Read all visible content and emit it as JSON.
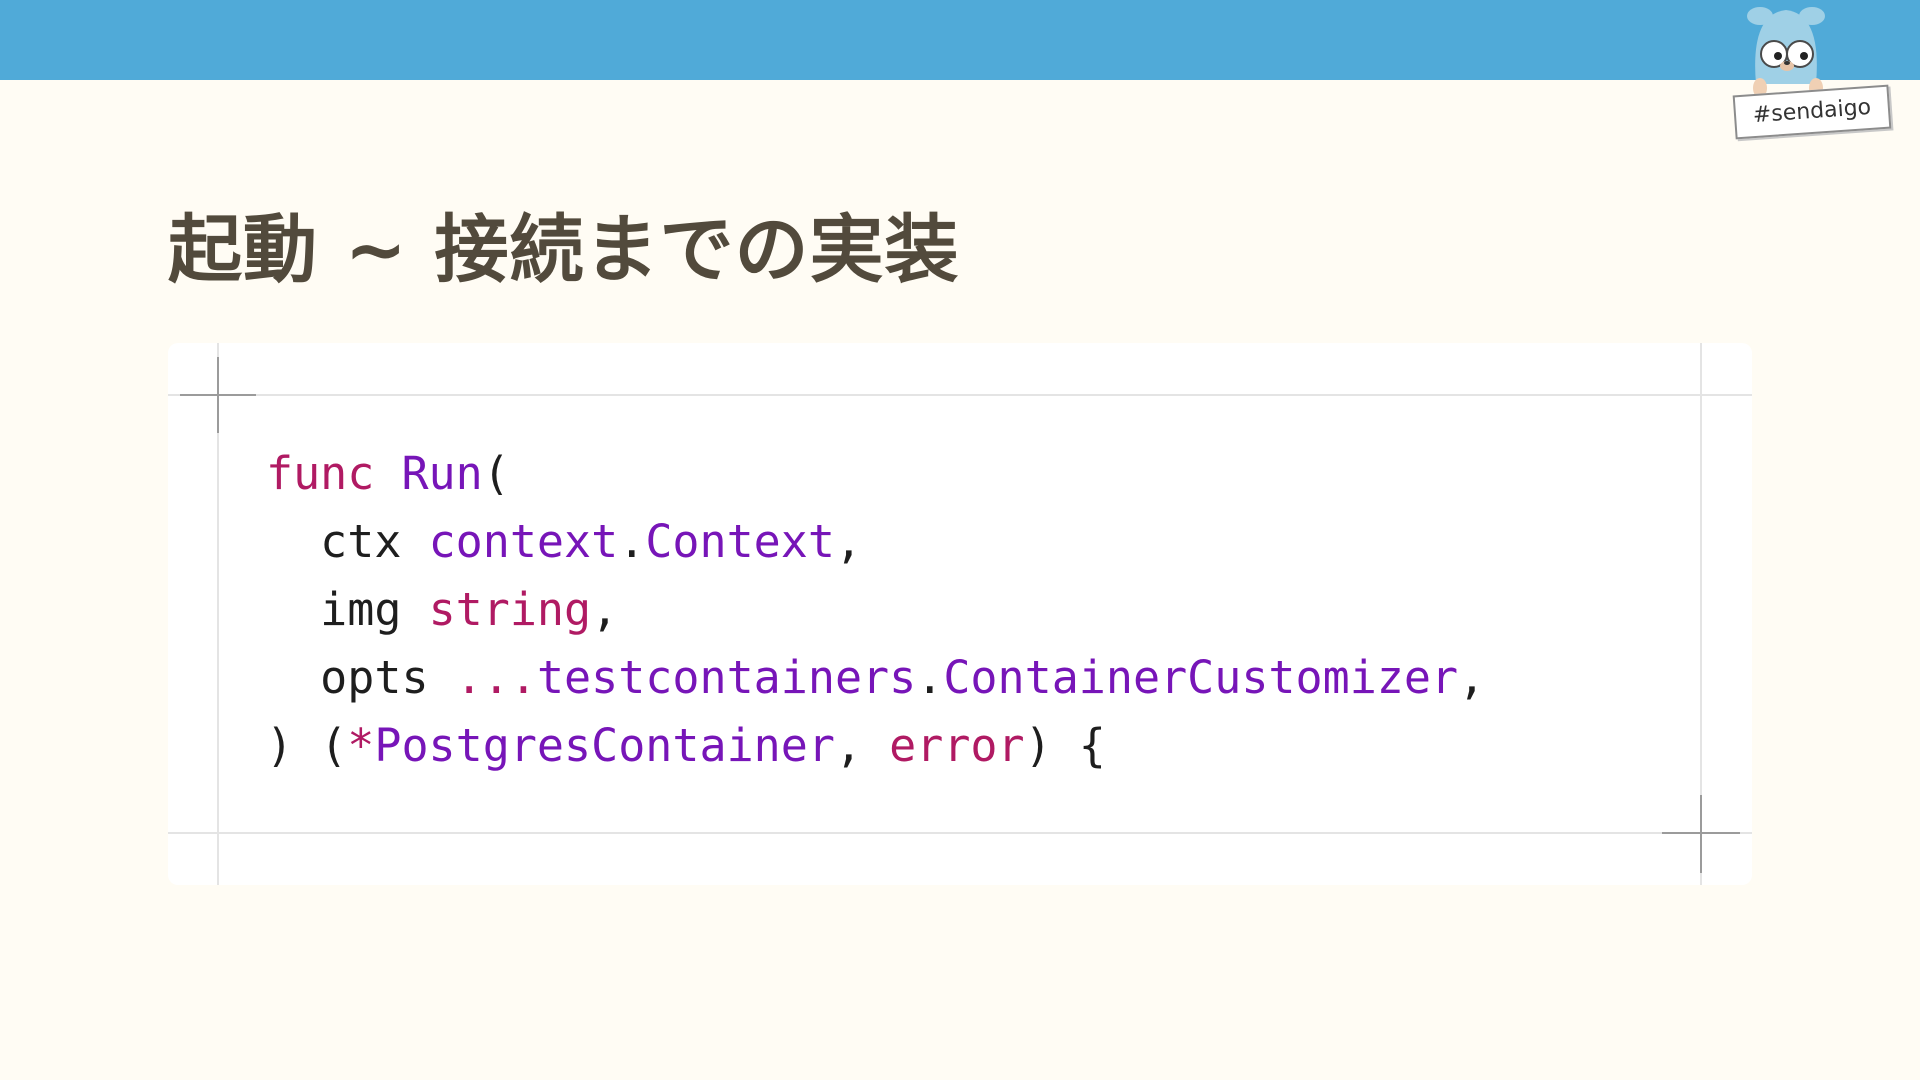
{
  "slide": {
    "title": "起動 ~ 接続までの実装",
    "hashtag": "#sendaigo"
  },
  "colors": {
    "topbar": "#50aad8",
    "background": "#fffcf4",
    "title": "#524a3c",
    "keyword": "#b01a63",
    "type": "#7715b8",
    "plain": "#1e1e1e"
  },
  "mascot": {
    "icon": "gopher-icon"
  },
  "code": {
    "language": "go",
    "lines": [
      [
        {
          "text": "func",
          "kind": "kw"
        },
        {
          "text": " ",
          "kind": "plain"
        },
        {
          "text": "Run",
          "kind": "ty"
        },
        {
          "text": "(",
          "kind": "plain"
        }
      ],
      [
        {
          "text": "  ctx ",
          "kind": "plain"
        },
        {
          "text": "context",
          "kind": "ty"
        },
        {
          "text": ".",
          "kind": "plain"
        },
        {
          "text": "Context",
          "kind": "ty"
        },
        {
          "text": ",",
          "kind": "plain"
        }
      ],
      [
        {
          "text": "  img ",
          "kind": "plain"
        },
        {
          "text": "string",
          "kind": "kw"
        },
        {
          "text": ",",
          "kind": "plain"
        }
      ],
      [
        {
          "text": "  opts ",
          "kind": "plain"
        },
        {
          "text": "...",
          "kind": "kw"
        },
        {
          "text": "testcontainers",
          "kind": "ty"
        },
        {
          "text": ".",
          "kind": "plain"
        },
        {
          "text": "ContainerCustomizer",
          "kind": "ty"
        },
        {
          "text": ",",
          "kind": "plain"
        }
      ],
      [
        {
          "text": ") (",
          "kind": "plain"
        },
        {
          "text": "*",
          "kind": "kw"
        },
        {
          "text": "PostgresContainer",
          "kind": "ty"
        },
        {
          "text": ", ",
          "kind": "plain"
        },
        {
          "text": "error",
          "kind": "kw"
        },
        {
          "text": ") {",
          "kind": "plain"
        }
      ]
    ]
  }
}
